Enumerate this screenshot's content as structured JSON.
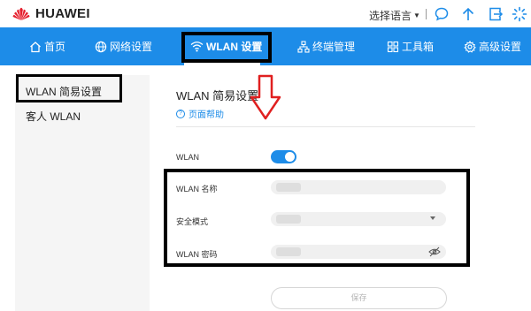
{
  "header": {
    "brand": "HUAWEI",
    "language_label": "选择语言",
    "icons": [
      "message-icon",
      "upload-icon",
      "logout-icon",
      "loading-icon"
    ]
  },
  "nav": {
    "items": [
      {
        "label": "首页",
        "icon": "home-icon"
      },
      {
        "label": "网络设置",
        "icon": "globe-icon"
      },
      {
        "label": "WLAN 设置",
        "icon": "wifi-icon",
        "active": true
      },
      {
        "label": "终端管理",
        "icon": "network-icon"
      },
      {
        "label": "工具箱",
        "icon": "toolbox-icon"
      },
      {
        "label": "高级设置",
        "icon": "gear-icon"
      }
    ]
  },
  "sidebar": {
    "items": [
      {
        "label": "WLAN 简易设置",
        "active": true
      },
      {
        "label": "客人 WLAN",
        "active": false
      }
    ]
  },
  "main": {
    "title": "WLAN 简易设置",
    "help_link": "页面帮助",
    "wlan_label": "WLAN",
    "wlan_enabled": true,
    "ssid_label": "WLAN 名称",
    "security_label": "安全模式",
    "password_label": "WLAN 密码",
    "save_label": "保存"
  },
  "colors": {
    "accent": "#1d8ce8",
    "brand_red": "#e5202e",
    "annotation": "#e02020"
  }
}
